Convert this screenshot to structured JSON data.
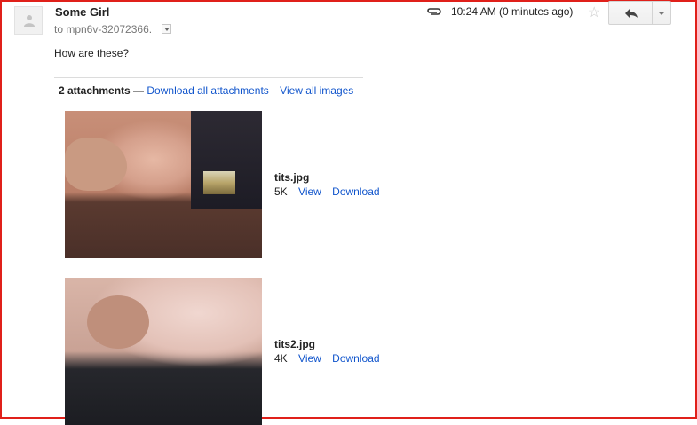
{
  "message": {
    "sender": "Some Girl",
    "recipient": "to mpn6v-32072366.",
    "timestamp": "10:24 AM (0 minutes ago)",
    "body": "How are these?"
  },
  "icons": {
    "avatar": "person-icon",
    "attachment": "paperclip-icon",
    "star": "star-icon",
    "reply": "reply-arrow-icon",
    "more": "chevron-down-icon"
  },
  "attachments_header": {
    "count": "2 attachments",
    "separator": "—",
    "download_all": "Download all attachments",
    "view_all": "View all images"
  },
  "attachments": [
    {
      "filename": "tits.jpg",
      "size": "5K",
      "view": "View",
      "download": "Download"
    },
    {
      "filename": "tits2.jpg",
      "size": "4K",
      "view": "View",
      "download": "Download"
    }
  ],
  "colors": {
    "link": "#1155cc",
    "frame_border": "#e0201a"
  }
}
